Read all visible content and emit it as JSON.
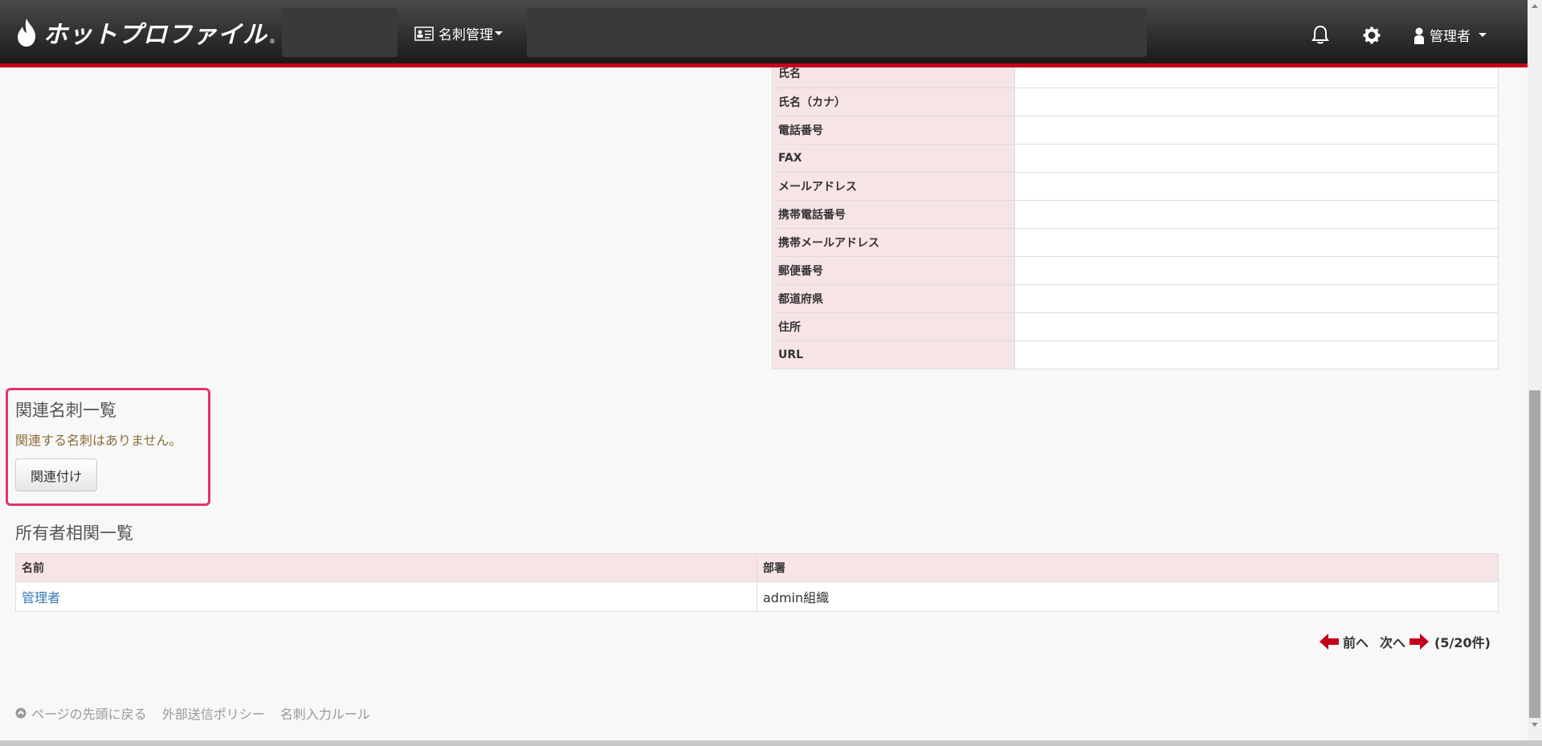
{
  "header": {
    "logo_text": "ホットプロファイル",
    "logo_reg": "®",
    "menu_label": "名刺管理",
    "user_label": "管理者"
  },
  "detail_rows": [
    {
      "label": "氏名",
      "value": ""
    },
    {
      "label": "氏名（カナ）",
      "value": ""
    },
    {
      "label": "電話番号",
      "value": ""
    },
    {
      "label": "FAX",
      "value": ""
    },
    {
      "label": "メールアドレス",
      "value": ""
    },
    {
      "label": "携帯電話番号",
      "value": ""
    },
    {
      "label": "携帯メールアドレス",
      "value": ""
    },
    {
      "label": "郵便番号",
      "value": ""
    },
    {
      "label": "都道府県",
      "value": ""
    },
    {
      "label": "住所",
      "value": ""
    },
    {
      "label": "URL",
      "value": ""
    }
  ],
  "related": {
    "title": "関連名刺一覧",
    "message": "関連する名刺はありません。",
    "button_label": "関連付け"
  },
  "owner": {
    "title": "所有者相関一覧",
    "columns": [
      "名前",
      "部署"
    ],
    "rows": [
      {
        "name": "管理者",
        "department": "admin組織"
      }
    ]
  },
  "pager": {
    "prev_label": "前へ",
    "next_label": "次へ",
    "count_text": "(5/20件)"
  },
  "footer": {
    "links": [
      "ページの先頭に戻る",
      "外部送信ポリシー",
      "名刺入力ルール"
    ]
  },
  "colors": {
    "accent": "#c4001b",
    "highlight_border": "#e5336d",
    "label_bg": "#f7e4e6"
  }
}
